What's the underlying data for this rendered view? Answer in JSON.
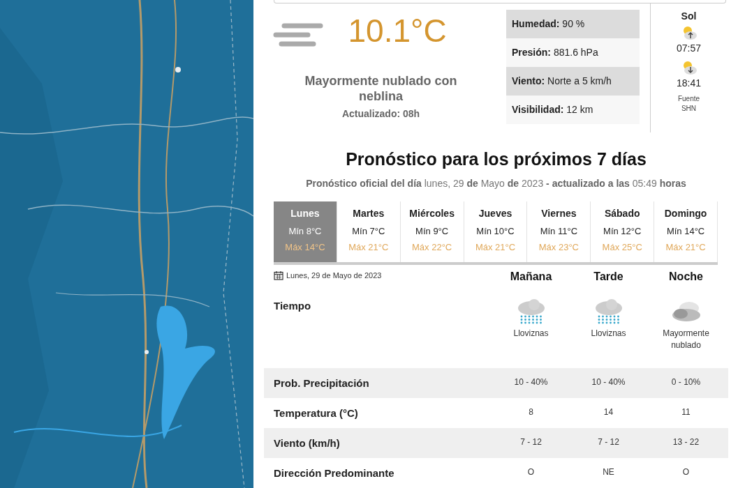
{
  "current": {
    "temperature": "10.1°C",
    "description": "Mayormente nublado con neblina",
    "updated": "Actualizado: 08h"
  },
  "stats": [
    {
      "label": "Humedad:",
      "value": "90 %"
    },
    {
      "label": "Presión:",
      "value": "881.6 hPa"
    },
    {
      "label": "Viento:",
      "value": "Norte a 5 km/h"
    },
    {
      "label": "Visibilidad:",
      "value": "12 km"
    }
  ],
  "sun": {
    "title": "Sol",
    "sunrise": "07:57",
    "sunset": "18:41",
    "source": "Fuente SHN"
  },
  "forecast": {
    "title": "Pronóstico para los próximos 7 días",
    "subtitle": "**Pronóstico oficial del día** lunes, 29 **de** Mayo **de** 2023 **- actualizado a las** 05:49 **horas**"
  },
  "days": [
    {
      "name": "Lunes",
      "min": "Mín 8°C",
      "max": "Máx 14°C",
      "selected": true
    },
    {
      "name": "Martes",
      "min": "Mín 7°C",
      "max": "Máx 21°C",
      "selected": false
    },
    {
      "name": "Miércoles",
      "min": "Mín 9°C",
      "max": "Máx 22°C",
      "selected": false
    },
    {
      "name": "Jueves",
      "min": "Mín 10°C",
      "max": "Máx 21°C",
      "selected": false
    },
    {
      "name": "Viernes",
      "min": "Mín 11°C",
      "max": "Máx 23°C",
      "selected": false
    },
    {
      "name": "Sábado",
      "min": "Mín 12°C",
      "max": "Máx 25°C",
      "selected": false
    },
    {
      "name": "Domingo",
      "min": "Mín 14°C",
      "max": "Máx 21°C",
      "selected": false
    }
  ],
  "detail": {
    "date": "Lunes, 29 de Mayo de 2023",
    "weather_label": "Tiempo",
    "periods": [
      {
        "name": "Mañana",
        "kind": "drizzle",
        "condition": "Lloviznas"
      },
      {
        "name": "Tarde",
        "kind": "drizzle",
        "condition": "Lloviznas"
      },
      {
        "name": "Noche",
        "kind": "cloudy",
        "condition": "Mayormente nublado"
      }
    ],
    "rows": [
      {
        "label": "Prob. Precipitación",
        "values": [
          "10 - 40%",
          "10 - 40%",
          "0 - 10%"
        ]
      },
      {
        "label": "Temperatura (°C)",
        "values": [
          "8",
          "14",
          "11"
        ]
      },
      {
        "label": "Viento (km/h)",
        "values": [
          "7 - 12",
          "7 - 12",
          "13 - 22"
        ]
      },
      {
        "label": "Dirección Predominante",
        "values": [
          "O",
          "NE",
          "O"
        ]
      }
    ]
  }
}
